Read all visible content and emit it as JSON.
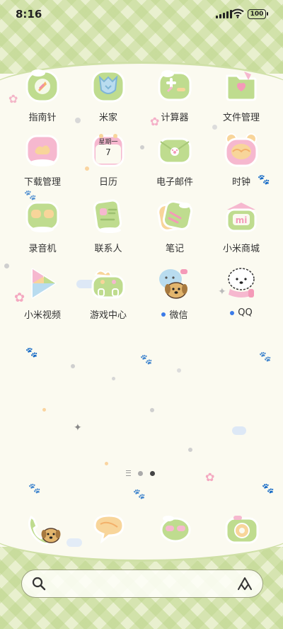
{
  "status_bar": {
    "time": "8:16",
    "battery": "100"
  },
  "apps": [
    {
      "label": "指南针",
      "icon": "compass-icon",
      "dot": false
    },
    {
      "label": "米家",
      "icon": "mijia-icon",
      "dot": false
    },
    {
      "label": "计算器",
      "icon": "calculator-icon",
      "dot": false
    },
    {
      "label": "文件管理",
      "icon": "folder-icon",
      "dot": false
    },
    {
      "label": "下载管理",
      "icon": "download-icon",
      "dot": false
    },
    {
      "label": "日历",
      "icon": "calendar-icon",
      "dot": false
    },
    {
      "label": "电子邮件",
      "icon": "email-icon",
      "dot": false
    },
    {
      "label": "时钟",
      "icon": "clock-icon",
      "dot": false
    },
    {
      "label": "录音机",
      "icon": "recorder-icon",
      "dot": false
    },
    {
      "label": "联系人",
      "icon": "contacts-icon",
      "dot": false
    },
    {
      "label": "笔记",
      "icon": "notes-icon",
      "dot": false
    },
    {
      "label": "小米商城",
      "icon": "mi-store-icon",
      "dot": false
    },
    {
      "label": "小米视频",
      "icon": "video-icon",
      "dot": false
    },
    {
      "label": "游戏中心",
      "icon": "game-center-icon",
      "dot": false
    },
    {
      "label": "微信",
      "icon": "wechat-icon",
      "dot": true
    },
    {
      "label": "QQ",
      "icon": "qq-icon",
      "dot": true
    }
  ],
  "calendar_icon": {
    "weekday": "星期一",
    "day": "7"
  },
  "mi_store_icon_text": "mi",
  "pager": {
    "pages": 2,
    "active_page": 2
  },
  "dock": [
    {
      "icon": "phone-icon"
    },
    {
      "icon": "messages-icon"
    },
    {
      "icon": "browser-icon"
    },
    {
      "icon": "camera-icon"
    }
  ],
  "search_bar": {
    "left_icon": "search-icon",
    "right_icon": "voice-assistant-icon"
  },
  "colors": {
    "icon_green": "#bfdc8f",
    "icon_pink": "#f6b8cf",
    "icon_peach": "#f8d59a",
    "background": "#fbfaf0",
    "plaid": "#e9f0cf",
    "badge_dot": "#3b7be8"
  }
}
